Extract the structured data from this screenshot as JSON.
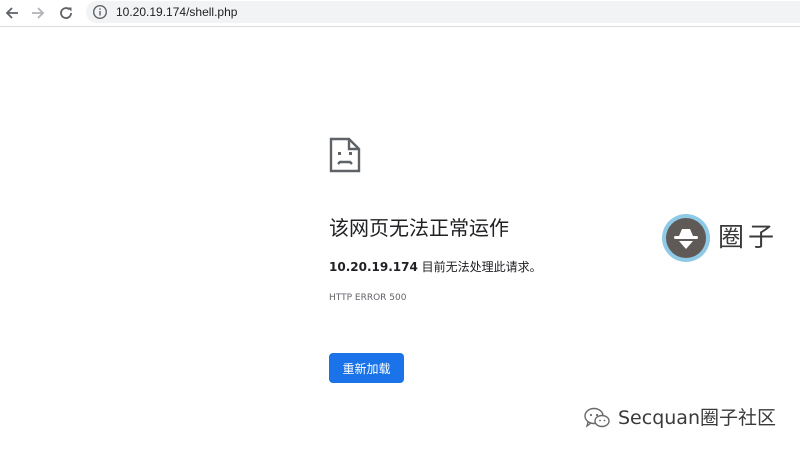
{
  "browser": {
    "url": "10.20.19.174/shell.php",
    "icons": [
      "back-arrow-icon",
      "forward-arrow-icon",
      "reload-icon",
      "info-icon"
    ]
  },
  "error_page": {
    "icon": "sad-document-icon",
    "title": "该网页无法正常运作",
    "host": "10.20.19.174",
    "message": " 目前无法处理此请求。",
    "error_code": "HTTP ERROR 500",
    "reload_label": "重新加载",
    "button_color": "#1a73e8"
  },
  "watermark": {
    "badge_icon": "hat-logo-icon",
    "brand_text": "圈子",
    "footer_icon": "wechat-icon",
    "footer_text": "Secquan圈子社区"
  }
}
